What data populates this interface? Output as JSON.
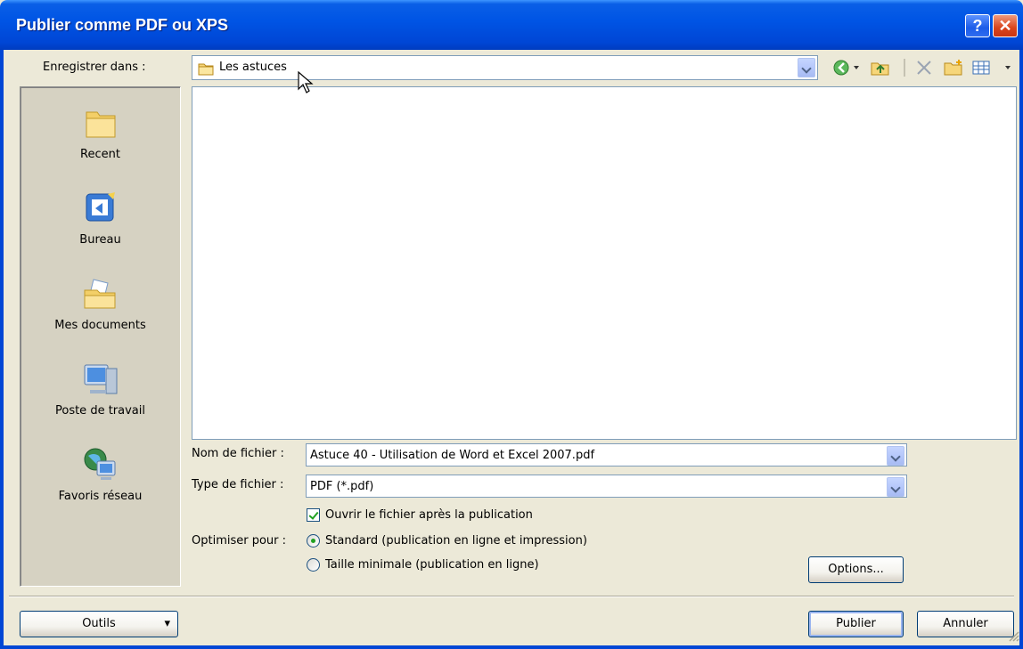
{
  "window": {
    "title": "Publier comme PDF ou XPS",
    "help_label": "?",
    "close_label": "✕"
  },
  "save_in": {
    "label": "Enregistrer dans :",
    "value": "Les astuces"
  },
  "places": [
    {
      "label": "Recent",
      "icon": "recent-folder-icon"
    },
    {
      "label": "Bureau",
      "icon": "desktop-icon"
    },
    {
      "label": "Mes documents",
      "icon": "my-documents-icon"
    },
    {
      "label": "Poste de travail",
      "icon": "my-computer-icon"
    },
    {
      "label": "Favoris réseau",
      "icon": "network-places-icon"
    }
  ],
  "filename": {
    "label": "Nom de fichier :",
    "value": "Astuce 40 - Utilisation de Word et Excel 2007.pdf"
  },
  "filetype": {
    "label": "Type de fichier :",
    "value": "PDF (*.pdf)"
  },
  "open_after": {
    "label": "Ouvrir le fichier après la publication",
    "checked": true
  },
  "optimize": {
    "label": "Optimiser pour :",
    "options": [
      {
        "label": "Standard (publication en ligne et impression)",
        "checked": true
      },
      {
        "label": "Taille minimale (publication en ligne)",
        "checked": false
      }
    ]
  },
  "buttons": {
    "options": "Options...",
    "tools": "Outils",
    "publish": "Publier",
    "cancel": "Annuler"
  },
  "colors": {
    "titlebar": "#0055e5",
    "dialog_bg": "#ece9d8",
    "check": "#21a121"
  }
}
